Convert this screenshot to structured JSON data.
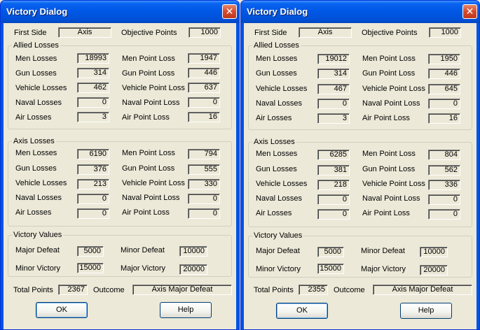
{
  "dialogs": [
    {
      "title": "Victory Dialog",
      "close_glyph": "✕",
      "first_side_label": "First Side",
      "first_side": "Axis",
      "objective_points_label": "Objective Points",
      "objective_points": "1000",
      "allied": {
        "title": "Allied Losses",
        "men_label": "Men Losses",
        "men": "18993",
        "men_pt_label": "Men Point Loss",
        "men_pt": "1947",
        "gun_label": "Gun Losses",
        "gun": "314",
        "gun_pt_label": "Gun Point Loss",
        "gun_pt": "446",
        "veh_label": "Vehicle Losses",
        "veh": "462",
        "veh_pt_label": "Vehicle Point Loss",
        "veh_pt": "637",
        "nav_label": "Naval Losses",
        "nav": "0",
        "nav_pt_label": "Naval Point Loss",
        "nav_pt": "0",
        "air_label": "Air Losses",
        "air": "3",
        "air_pt_label": "Air Point Loss",
        "air_pt": "16"
      },
      "axis": {
        "title": "Axis Losses",
        "men_label": "Men Losses",
        "men": "6190",
        "men_pt_label": "Men Point Loss",
        "men_pt": "794",
        "gun_label": "Gun Losses",
        "gun": "376",
        "gun_pt_label": "Gun Point Loss",
        "gun_pt": "555",
        "veh_label": "Vehicle Losses",
        "veh": "213",
        "veh_pt_label": "Vehicle Point Loss",
        "veh_pt": "330",
        "nav_label": "Naval Losses",
        "nav": "0",
        "nav_pt_label": "Naval Point Loss",
        "nav_pt": "0",
        "air_label": "Air Losses",
        "air": "0",
        "air_pt_label": "Air Point Loss",
        "air_pt": "0"
      },
      "victory": {
        "title": "Victory Values",
        "major_defeat_label": "Major Defeat",
        "major_defeat": "5000",
        "minor_defeat_label": "Minor Defeat",
        "minor_defeat": "10000",
        "minor_victory_label": "Minor Victory",
        "minor_victory": "15000",
        "major_victory_label": "Major Victory",
        "major_victory": "20000"
      },
      "total_points_label": "Total Points",
      "total_points": "2367",
      "outcome_label": "Outcome",
      "outcome": "Axis Major Defeat",
      "ok_label": "OK",
      "help_label": "Help"
    },
    {
      "title": "Victory Dialog",
      "close_glyph": "✕",
      "first_side_label": "First Side",
      "first_side": "Axis",
      "objective_points_label": "Objective Points",
      "objective_points": "1000",
      "allied": {
        "title": "Allied Losses",
        "men_label": "Men Losses",
        "men": "19012",
        "men_pt_label": "Men Point Loss",
        "men_pt": "1950",
        "gun_label": "Gun Losses",
        "gun": "314",
        "gun_pt_label": "Gun Point Loss",
        "gun_pt": "446",
        "veh_label": "Vehicle Losses",
        "veh": "467",
        "veh_pt_label": "Vehicle Point Loss",
        "veh_pt": "645",
        "nav_label": "Naval Losses",
        "nav": "0",
        "nav_pt_label": "Naval Point Loss",
        "nav_pt": "0",
        "air_label": "Air Losses",
        "air": "3",
        "air_pt_label": "Air Point Loss",
        "air_pt": "16"
      },
      "axis": {
        "title": "Axis Losses",
        "men_label": "Men Losses",
        "men": "6285",
        "men_pt_label": "Men Point Loss",
        "men_pt": "804",
        "gun_label": "Gun Losses",
        "gun": "381",
        "gun_pt_label": "Gun Point Loss",
        "gun_pt": "562",
        "veh_label": "Vehicle Losses",
        "veh": "218",
        "veh_pt_label": "Vehicle Point Loss",
        "veh_pt": "336",
        "nav_label": "Naval Losses",
        "nav": "0",
        "nav_pt_label": "Naval Point Loss",
        "nav_pt": "0",
        "air_label": "Air Losses",
        "air": "0",
        "air_pt_label": "Air Point Loss",
        "air_pt": "0"
      },
      "victory": {
        "title": "Victory Values",
        "major_defeat_label": "Major Defeat",
        "major_defeat": "5000",
        "minor_defeat_label": "Minor Defeat",
        "minor_defeat": "10000",
        "minor_victory_label": "Minor Victory",
        "minor_victory": "15000",
        "major_victory_label": "Major Victory",
        "major_victory": "20000"
      },
      "total_points_label": "Total Points",
      "total_points": "2355",
      "outcome_label": "Outcome",
      "outcome": "Axis Major Defeat",
      "ok_label": "OK",
      "help_label": "Help"
    }
  ]
}
